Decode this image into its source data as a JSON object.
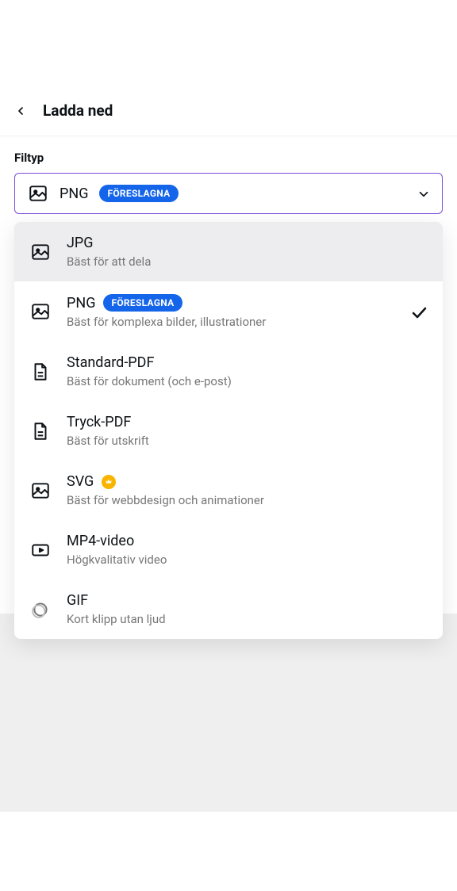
{
  "header": {
    "title": "Ladda ned"
  },
  "filetype": {
    "label": "Filtyp",
    "selected": "PNG",
    "badge": "FÖRESLAGNA"
  },
  "options": [
    {
      "title": "JPG",
      "desc": "Bäst för att dela",
      "icon": "image",
      "highlight": true,
      "badge": null,
      "premium": false,
      "selected": false
    },
    {
      "title": "PNG",
      "desc": "Bäst för komplexa bilder, illustrationer",
      "icon": "image",
      "highlight": false,
      "badge": "FÖRESLAGNA",
      "premium": false,
      "selected": true
    },
    {
      "title": "Standard-PDF",
      "desc": "Bäst för dokument (och e-post)",
      "icon": "pdf",
      "highlight": false,
      "badge": null,
      "premium": false,
      "selected": false
    },
    {
      "title": "Tryck-PDF",
      "desc": "Bäst för utskrift",
      "icon": "pdf",
      "highlight": false,
      "badge": null,
      "premium": false,
      "selected": false
    },
    {
      "title": "SVG",
      "desc": "Bäst för webbdesign och animationer",
      "icon": "image",
      "highlight": false,
      "badge": null,
      "premium": true,
      "selected": false
    },
    {
      "title": "MP4-video",
      "desc": "Högkvalitativ video",
      "icon": "video",
      "highlight": false,
      "badge": null,
      "premium": false,
      "selected": false
    },
    {
      "title": "GIF",
      "desc": "Kort klipp utan ljud",
      "icon": "gif",
      "highlight": false,
      "badge": null,
      "premium": false,
      "selected": false
    }
  ]
}
